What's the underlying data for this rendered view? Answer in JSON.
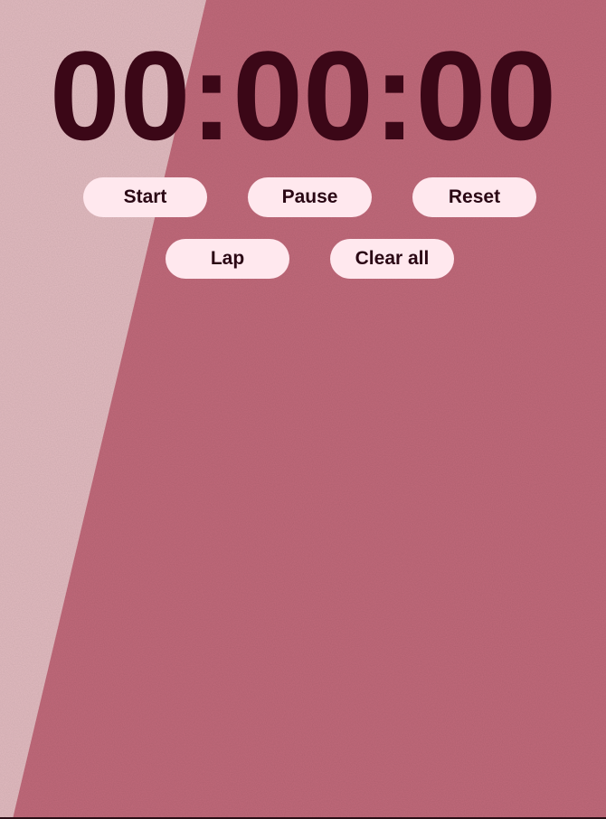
{
  "stopwatch": {
    "display": "00:00:00"
  },
  "controls": {
    "start_label": "Start",
    "pause_label": "Pause",
    "reset_label": "Reset",
    "lap_label": "Lap",
    "clear_all_label": "Clear all"
  },
  "colors": {
    "background_light": "#e3bcc1",
    "background_main": "#c26a7b",
    "timer_text": "#3b0717",
    "button_bg": "#ffe8ee",
    "button_text": "#2a0714"
  }
}
